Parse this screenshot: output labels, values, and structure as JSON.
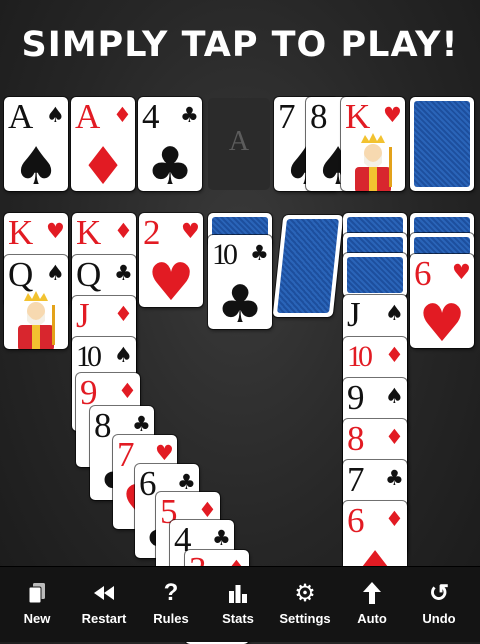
{
  "banner": {
    "text": "SIMPLY TAP TO PLAY!"
  },
  "foundation_placeholder": "A",
  "colors": {
    "red": "#e21b23",
    "black": "#111111",
    "card_back": "#1d4f9e"
  },
  "cards": {
    "f_as": {
      "rank": "A",
      "suit": "♠"
    },
    "f_ad": {
      "rank": "A",
      "suit": "♦"
    },
    "f_4c": {
      "rank": "4",
      "suit": "♣"
    },
    "w_7s": {
      "rank": "7",
      "suit": "♠"
    },
    "w_8s": {
      "rank": "8",
      "suit": "♠"
    },
    "w_kh": {
      "rank": "K",
      "suit": "♥"
    },
    "t1_kh": {
      "rank": "K",
      "suit": "♥"
    },
    "t1_qs": {
      "rank": "Q",
      "suit": "♠"
    },
    "t2_kd": {
      "rank": "K",
      "suit": "♦"
    },
    "t2_qc": {
      "rank": "Q",
      "suit": "♣"
    },
    "t2_jd": {
      "rank": "J",
      "suit": "♦"
    },
    "t2_10s": {
      "rank": "10",
      "suit": "♠"
    },
    "t2_9d": {
      "rank": "9",
      "suit": "♦"
    },
    "t2_8c": {
      "rank": "8",
      "suit": "♣"
    },
    "t2_7h": {
      "rank": "7",
      "suit": "♥"
    },
    "t2_6c": {
      "rank": "6",
      "suit": "♣"
    },
    "t2_5d": {
      "rank": "5",
      "suit": "♦"
    },
    "t2_4c": {
      "rank": "4",
      "suit": "♣"
    },
    "t2_3d": {
      "rank": "3",
      "suit": "♦"
    },
    "t3_2h": {
      "rank": "2",
      "suit": "♥"
    },
    "t4_10c": {
      "rank": "10",
      "suit": "♣"
    },
    "t6_js": {
      "rank": "J",
      "suit": "♠"
    },
    "t6_10d": {
      "rank": "10",
      "suit": "♦"
    },
    "t6_9s": {
      "rank": "9",
      "suit": "♠"
    },
    "t6_8d": {
      "rank": "8",
      "suit": "♦"
    },
    "t6_7c": {
      "rank": "7",
      "suit": "♣"
    },
    "t6_6d": {
      "rank": "6",
      "suit": "♦"
    },
    "t7_6h": {
      "rank": "6",
      "suit": "♥"
    }
  },
  "toolbar": [
    {
      "label": "New",
      "icon": "new-cards-icon",
      "glyph": "❐"
    },
    {
      "label": "Restart",
      "icon": "rewind-icon",
      "glyph": "◀◀"
    },
    {
      "label": "Rules",
      "icon": "question-icon",
      "glyph": "?"
    },
    {
      "label": "Stats",
      "icon": "bar-chart-icon",
      "glyph": "▮"
    },
    {
      "label": "Settings",
      "icon": "gear-icon",
      "glyph": "⚙"
    },
    {
      "label": "Auto",
      "icon": "arrow-up-icon",
      "glyph": "⬆"
    },
    {
      "label": "Undo",
      "icon": "undo-icon",
      "glyph": "↺"
    }
  ]
}
